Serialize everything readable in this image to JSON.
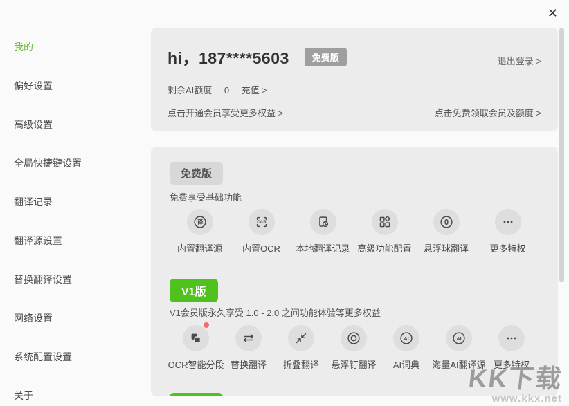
{
  "window": {
    "close": "✕"
  },
  "sidebar": {
    "items": [
      {
        "label": "我的",
        "active": true
      },
      {
        "label": "偏好设置"
      },
      {
        "label": "高级设置"
      },
      {
        "label": "全局快捷键设置"
      },
      {
        "label": "翻译记录"
      },
      {
        "label": "翻译源设置"
      },
      {
        "label": "替换翻译设置"
      },
      {
        "label": "网络设置"
      },
      {
        "label": "系统配置设置"
      },
      {
        "label": "关于"
      }
    ]
  },
  "account": {
    "greeting": "hi，187****5603",
    "plan_badge": "免费版",
    "logout": "退出登录 >",
    "quota_label": "剩余AI额度",
    "quota_value": "0",
    "recharge": "充值 >",
    "member_cta": "点击开通会员享受更多权益 >",
    "claim_cta": "点击免费领取会员及额度 >"
  },
  "plans": {
    "free": {
      "badge": "免费版",
      "desc": "免费享受基础功能",
      "features": [
        {
          "label": "内置翻译源",
          "icon": "translate-icon"
        },
        {
          "label": "内置OCR",
          "icon": "ocr-icon"
        },
        {
          "label": "本地翻译记录",
          "icon": "local-history-icon"
        },
        {
          "label": "高级功能配置",
          "icon": "advanced-grid-icon"
        },
        {
          "label": "悬浮球翻译",
          "icon": "float-ball-icon"
        },
        {
          "label": "更多特权",
          "icon": "more-icon"
        }
      ]
    },
    "v1": {
      "badge": "V1版",
      "desc": "V1会员版永久享受 1.0 - 2.0 之间功能体验等更多权益",
      "features": [
        {
          "label": "OCR智能分段",
          "icon": "ocr-segment-icon",
          "notification_dot": true
        },
        {
          "label": "替换翻译",
          "icon": "swap-icon"
        },
        {
          "label": "折叠翻译",
          "icon": "fold-icon"
        },
        {
          "label": "悬浮钉翻译",
          "icon": "pin-icon"
        },
        {
          "label": "AI词典",
          "icon": "ai-dict-icon"
        },
        {
          "label": "海量AI翻译源",
          "icon": "ai-sources-icon"
        },
        {
          "label": "更多特权",
          "icon": "more-icon"
        }
      ]
    }
  },
  "icon_glyphs": {
    "translate": "译",
    "ocr": "OCR",
    "ai": "AI"
  },
  "watermark": {
    "title": "KK下载",
    "site": "www.kkx.net"
  },
  "colors": {
    "accent_green": "#4fc21e",
    "sidebar_active_green": "#6dbf3f",
    "card_bg": "#ececec",
    "top_badge_gray": "#9e9e9e",
    "plan_badge_gray": "#d8d8d8",
    "icon_circle_gray": "#dedede",
    "notification_red": "#f36c6c"
  }
}
